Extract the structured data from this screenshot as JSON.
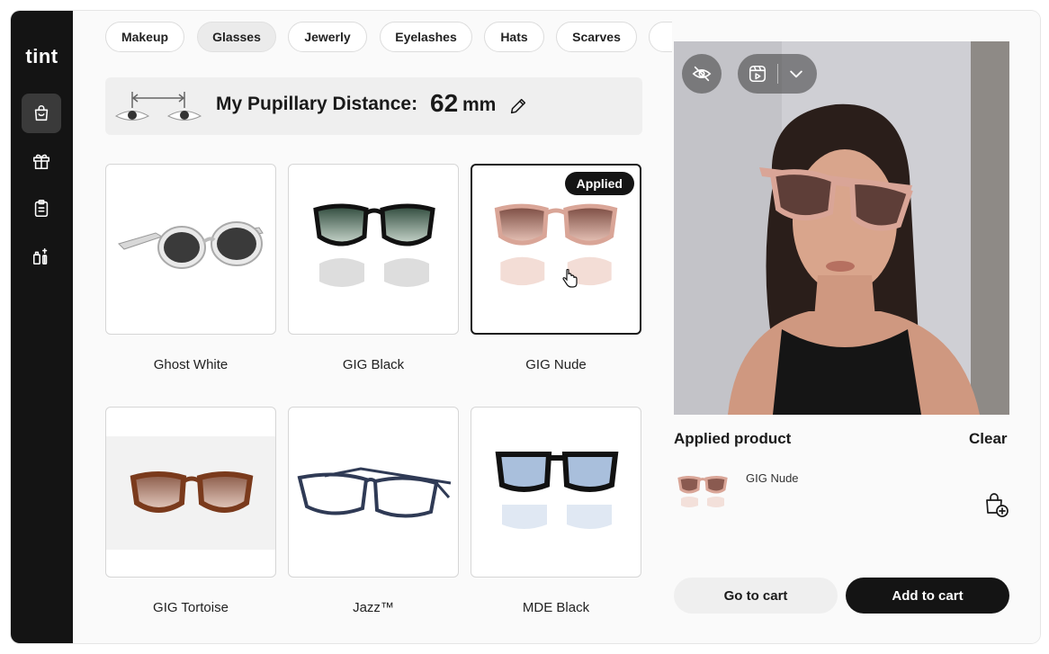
{
  "app": {
    "logo": "tint"
  },
  "sidebar": {
    "items": [
      {
        "icon": "shopping-bag-icon",
        "active": true
      },
      {
        "icon": "gift-icon",
        "active": false
      },
      {
        "icon": "clipboard-icon",
        "active": false
      },
      {
        "icon": "beauty-products-icon",
        "active": false
      }
    ]
  },
  "categories": {
    "items": [
      "Makeup",
      "Glasses",
      "Jewerly",
      "Eyelashes",
      "Hats",
      "Scarves"
    ],
    "active": "Glasses"
  },
  "pupillary": {
    "label": "My Pupillary Distance:",
    "value": "62",
    "unit": "mm",
    "edit_icon": "pencil-icon"
  },
  "products": [
    {
      "name": "Ghost White",
      "frame": "#e3e3e3",
      "lens": "#3a3a3a"
    },
    {
      "name": "GIG Black",
      "frame": "#111111",
      "lens": "#4a5a52"
    },
    {
      "name": "GIG Nude",
      "frame": "#d9a597",
      "lens": "#7a4a40",
      "badge": "Applied"
    },
    {
      "name": "GIG Tortoise",
      "frame": "#7a3a1c",
      "lens": "#9b6d5c"
    },
    {
      "name": "Jazz™",
      "frame": "#3c4a66",
      "lens": "none"
    },
    {
      "name": "MDE Black",
      "frame": "#111111",
      "lens": "#a9bfdc"
    }
  ],
  "preview": {
    "controls": [
      "eye-off-icon",
      "video-icon",
      "chevron-down-icon"
    ]
  },
  "applied": {
    "title": "Applied product",
    "clear_label": "Clear",
    "item_name": "GIG Nude",
    "add_bag_icon": "bag-plus-icon"
  },
  "actions": {
    "go_to_cart": "Go to cart",
    "add_to_cart": "Add to cart"
  },
  "colors": {
    "sidebar_bg": "#141414",
    "accent": "#141414"
  }
}
